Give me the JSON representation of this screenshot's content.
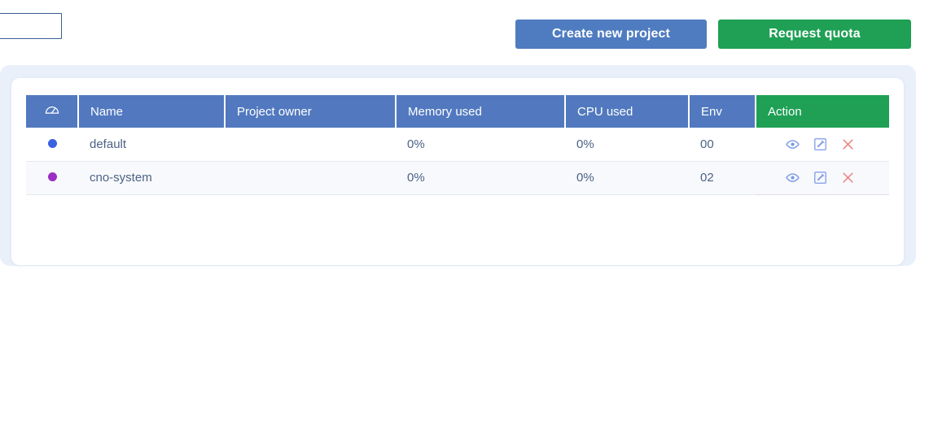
{
  "toolbar": {
    "name_input": {
      "value": "",
      "placeholder": ""
    },
    "create_button": {
      "label": "Create new project",
      "color": "#4f7cc0"
    },
    "quota_button": {
      "label": "Request quota",
      "color": "#1fa055"
    }
  },
  "table": {
    "columns": [
      "",
      "Name",
      "Project owner",
      "Memory used",
      "CPU used",
      "Env",
      "Action"
    ],
    "header_icon": "dashboard-gauge-icon",
    "header_color": "#5279bf",
    "action_header_color": "#1fa055",
    "row_actions": [
      "view-icon",
      "edit-icon",
      "delete-icon"
    ],
    "rows": [
      {
        "status_color": "#3b62e0",
        "name": "default",
        "owner": "",
        "memory": "0%",
        "cpu": "0%",
        "env": "00"
      },
      {
        "status_color": "#9b2fc4",
        "name": "cno-system",
        "owner": "",
        "memory": "0%",
        "cpu": "0%",
        "env": "02"
      }
    ]
  },
  "theme": {
    "page_background": "#ffffff",
    "shell_background": "#eaf0fa",
    "card_background": "#ffffff",
    "alt_row_background": "#f8f9fc",
    "cell_text": "#4a6285",
    "action_view": "#7c9ae8",
    "action_edit": "#7c9ae8",
    "action_delete": "#f08080"
  }
}
